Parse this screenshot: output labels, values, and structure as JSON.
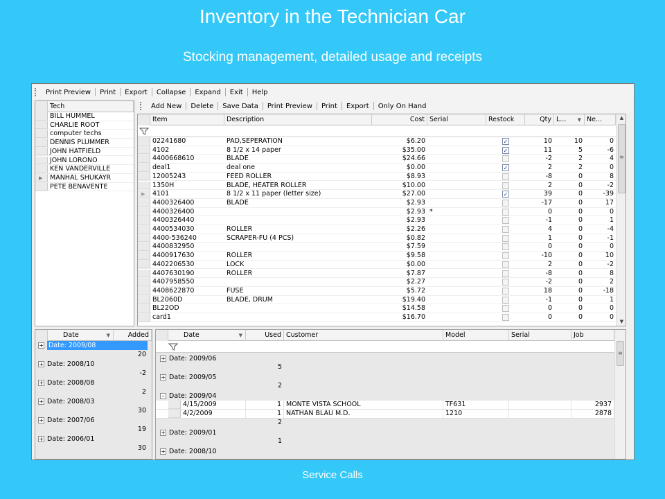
{
  "slide": {
    "title": "Inventory in the Technician Car",
    "subtitle": "Stocking management, detailed usage and receipts",
    "footer": "Service Calls"
  },
  "main_toolbar": [
    "Print Preview",
    "Print",
    "Export",
    "Collapse",
    "Expand",
    "Exit",
    "Help"
  ],
  "grid_toolbar": [
    "Add New",
    "Delete",
    "Save Data",
    "Print Preview",
    "Print",
    "Export",
    "Only On Hand"
  ],
  "tech_panel": {
    "header": "Tech",
    "techs": [
      "BILL HUMMEL",
      "CHARLIE ROOT",
      "computer techs",
      "DENNIS PLUMMER",
      "JOHN HATFIELD",
      "JOHN LORONO",
      "KEN VANDERVILLE",
      "MANHAL SHUKAYR",
      "PETE BENAVENTE"
    ]
  },
  "inventory": {
    "columns": [
      "Item",
      "Description",
      "Cost",
      "Serial",
      "Restock",
      "Qty",
      "L...",
      "Ne..."
    ],
    "rows": [
      {
        "item": "02241680",
        "desc": "PAD,SEPERATION",
        "cost": "$6.20",
        "serial": "",
        "restock": true,
        "qty": "10",
        "l": "10",
        "ne": "0"
      },
      {
        "item": "4102",
        "desc": "8 1/2 x 14 paper",
        "cost": "$35.00",
        "serial": "",
        "restock": true,
        "qty": "11",
        "l": "5",
        "ne": "-6"
      },
      {
        "item": "4400668610",
        "desc": "BLADE",
        "cost": "$24.66",
        "serial": "",
        "restock": false,
        "qty": "-2",
        "l": "2",
        "ne": "4"
      },
      {
        "item": "deal1",
        "desc": "deal one",
        "cost": "$0.00",
        "serial": "",
        "restock": true,
        "qty": "2",
        "l": "2",
        "ne": "0"
      },
      {
        "item": "12005243",
        "desc": "FEED ROLLER",
        "cost": "$8.93",
        "serial": "",
        "restock": false,
        "qty": "-8",
        "l": "0",
        "ne": "8"
      },
      {
        "item": "1350H",
        "desc": "BLADE, HEATER ROLLER",
        "cost": "$10.00",
        "serial": "",
        "restock": false,
        "qty": "2",
        "l": "0",
        "ne": "-2"
      },
      {
        "item": "4101",
        "desc": "8 1/2 x 11 paper (letter size)",
        "cost": "$27.00",
        "serial": "",
        "restock": true,
        "qty": "39",
        "l": "0",
        "ne": "-39"
      },
      {
        "item": "4400326400",
        "desc": "BLADE",
        "cost": "$2.93",
        "serial": "",
        "restock": false,
        "qty": "-17",
        "l": "0",
        "ne": "17"
      },
      {
        "item": "4400326400",
        "desc": "",
        "cost": "$2.93",
        "serial": "*",
        "restock": false,
        "qty": "0",
        "l": "0",
        "ne": "0"
      },
      {
        "item": "4400326440",
        "desc": "",
        "cost": "$2.93",
        "serial": "",
        "restock": false,
        "qty": "-1",
        "l": "0",
        "ne": "1"
      },
      {
        "item": "4400534030",
        "desc": "ROLLER",
        "cost": "$2.26",
        "serial": "",
        "restock": false,
        "qty": "4",
        "l": "0",
        "ne": "-4"
      },
      {
        "item": "4400-536240",
        "desc": "SCRAPER-FU (4 PCS)",
        "cost": "$0.82",
        "serial": "",
        "restock": false,
        "qty": "1",
        "l": "0",
        "ne": "-1"
      },
      {
        "item": "4400832950",
        "desc": "",
        "cost": "$7.59",
        "serial": "",
        "restock": false,
        "qty": "0",
        "l": "0",
        "ne": "0"
      },
      {
        "item": "4400917630",
        "desc": "ROLLER",
        "cost": "$9.58",
        "serial": "",
        "restock": false,
        "qty": "-10",
        "l": "0",
        "ne": "10"
      },
      {
        "item": "4402206530",
        "desc": "LOCK",
        "cost": "$0.00",
        "serial": "",
        "restock": false,
        "qty": "2",
        "l": "0",
        "ne": "-2"
      },
      {
        "item": "4407630190",
        "desc": "ROLLER",
        "cost": "$7.87",
        "serial": "",
        "restock": false,
        "qty": "-8",
        "l": "0",
        "ne": "8"
      },
      {
        "item": "4407958550",
        "desc": "",
        "cost": "$2.27",
        "serial": "",
        "restock": false,
        "qty": "-2",
        "l": "0",
        "ne": "2"
      },
      {
        "item": "4408622870",
        "desc": "FUSE",
        "cost": "$5.72",
        "serial": "",
        "restock": false,
        "qty": "18",
        "l": "0",
        "ne": "-18"
      },
      {
        "item": "BL2060D",
        "desc": "BLADE, DRUM",
        "cost": "$19.40",
        "serial": "",
        "restock": false,
        "qty": "-1",
        "l": "0",
        "ne": "1"
      },
      {
        "item": "BL22OD",
        "desc": "",
        "cost": "$14.58",
        "serial": "",
        "restock": false,
        "qty": "0",
        "l": "0",
        "ne": "0"
      },
      {
        "item": "card1",
        "desc": "",
        "cost": "$16.70",
        "serial": "",
        "restock": false,
        "qty": "0",
        "l": "0",
        "ne": "0"
      }
    ]
  },
  "receipts": {
    "columns": [
      "Date",
      "Added"
    ],
    "groups": [
      {
        "label": "Date:  2009/08",
        "added": "20"
      },
      {
        "label": "Date:  2008/10",
        "added": "-2"
      },
      {
        "label": "Date:  2008/08",
        "added": "2"
      },
      {
        "label": "Date:  2008/03",
        "added": "30"
      },
      {
        "label": "Date:  2007/06",
        "added": "19"
      },
      {
        "label": "Date:  2006/01",
        "added": "30"
      }
    ]
  },
  "usage": {
    "columns": [
      "Date",
      "Used",
      "Customer",
      "Model",
      "Serial",
      "Job"
    ],
    "groups": [
      {
        "label": "Date:  2009/06",
        "sign": "+",
        "total": "5",
        "rows": []
      },
      {
        "label": "Date:  2009/05",
        "sign": "+",
        "total": "2",
        "rows": []
      },
      {
        "label": "Date:  2009/04",
        "sign": "–",
        "total": "2",
        "rows": [
          {
            "date": "4/15/2009",
            "used": "1",
            "customer": "MONTE VISTA SCHOOL",
            "model": "TF631",
            "serial": "",
            "job": "2937"
          },
          {
            "date": "4/2/2009",
            "used": "1",
            "customer": "NATHAN BLAU M.D.",
            "model": "1210",
            "serial": "",
            "job": "2878"
          }
        ]
      },
      {
        "label": "Date:  2009/01",
        "sign": "+",
        "total": "1",
        "rows": []
      },
      {
        "label": "Date:  2008/10",
        "sign": "+",
        "total": "",
        "rows": []
      }
    ]
  }
}
